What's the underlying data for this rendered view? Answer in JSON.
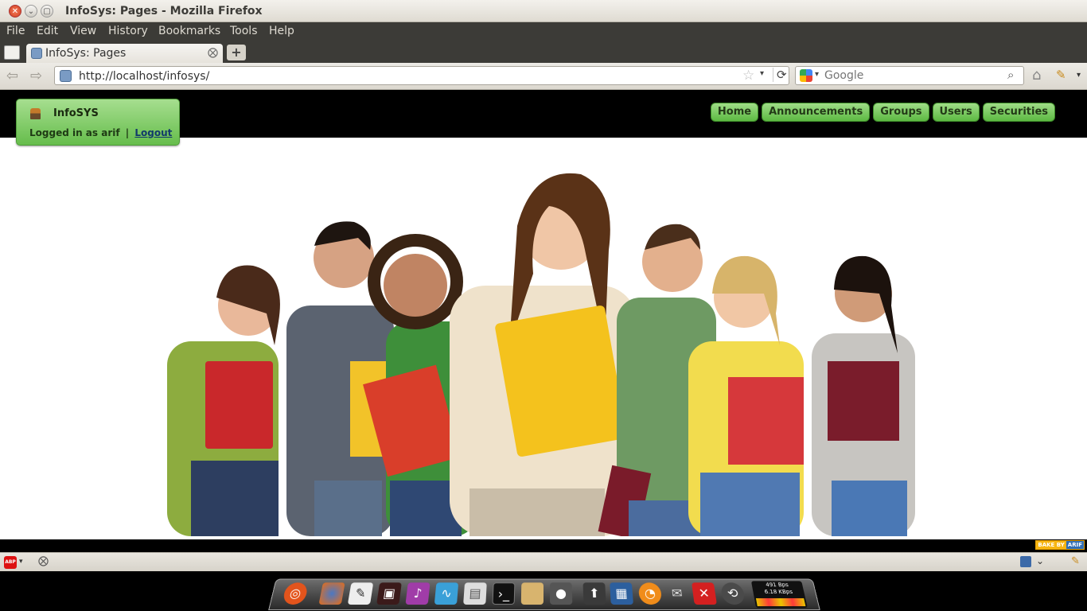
{
  "window": {
    "title": "InfoSys: Pages - Mozilla Firefox",
    "buttons": {
      "close": "✕",
      "minimize": "⌄",
      "maximize": "▢"
    }
  },
  "menu": [
    "File",
    "Edit",
    "View",
    "History",
    "Bookmarks",
    "Tools",
    "Help"
  ],
  "tabs": [
    {
      "label": "InfoSys: Pages",
      "close": "⨂"
    }
  ],
  "new_tab": "+",
  "nav": {
    "back": "⇦",
    "forward": "⇨",
    "url": "http://localhost/infosys/",
    "bookmark_star": "☆",
    "url_dropdown": "▾",
    "reload": "⟳",
    "search_engine_dropdown": "▾",
    "search_placeholder": "Google",
    "search_icon": "⌕",
    "home": "⌂",
    "addon": "✎",
    "addon_dropdown": "▾"
  },
  "site": {
    "brand": "InfoSYS",
    "logged_in_text": "Logged in as arif",
    "separator": "|",
    "logout_label": "Logout",
    "nav_items": [
      "Home",
      "Announcements",
      "Groups",
      "Users",
      "Securities"
    ],
    "made_by": [
      "BAKE BY",
      "ARIF"
    ]
  },
  "statusbar": {
    "adblock_label": "ABP",
    "adblock_dropdown": "▾",
    "close": "⨂",
    "tool_dropdown": "⌄",
    "addon": "✎"
  },
  "dock": {
    "network_rate_up": "491 Bps",
    "network_rate_down": "6.18 KBps"
  },
  "colors": {
    "ubuntu_dark": "#3c3b37",
    "site_green": "#66bd4c",
    "site_header": "#000000"
  }
}
